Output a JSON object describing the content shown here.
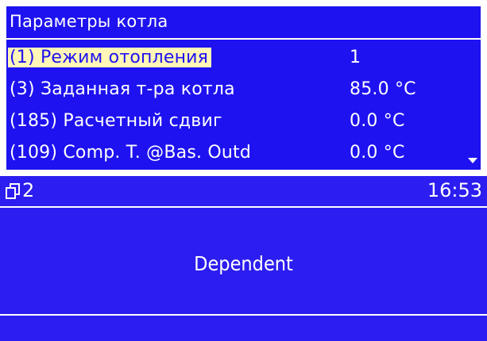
{
  "top_panel": {
    "title": "Параметры котла",
    "rows": [
      {
        "label": "(1) Режим отопления",
        "value": "1"
      },
      {
        "label": "(3) Заданная т-ра котла",
        "value": "85.0 °C"
      },
      {
        "label": "(185) Расчетный сдвиг",
        "value": "0.0 °C"
      },
      {
        "label": "(109) Comp. T. @Bas. Outd",
        "value": "0.0 °C"
      }
    ],
    "colors": {
      "background": "#1e12f0",
      "selection": "#fff6b8",
      "text": "#ffffff"
    }
  },
  "bottom_panel": {
    "page_number": "2",
    "time": "16:53",
    "message": "Dependent",
    "icons": [
      "pages-icon"
    ],
    "colors": {
      "background": "#2c1df0",
      "text": "#ffffff"
    }
  }
}
